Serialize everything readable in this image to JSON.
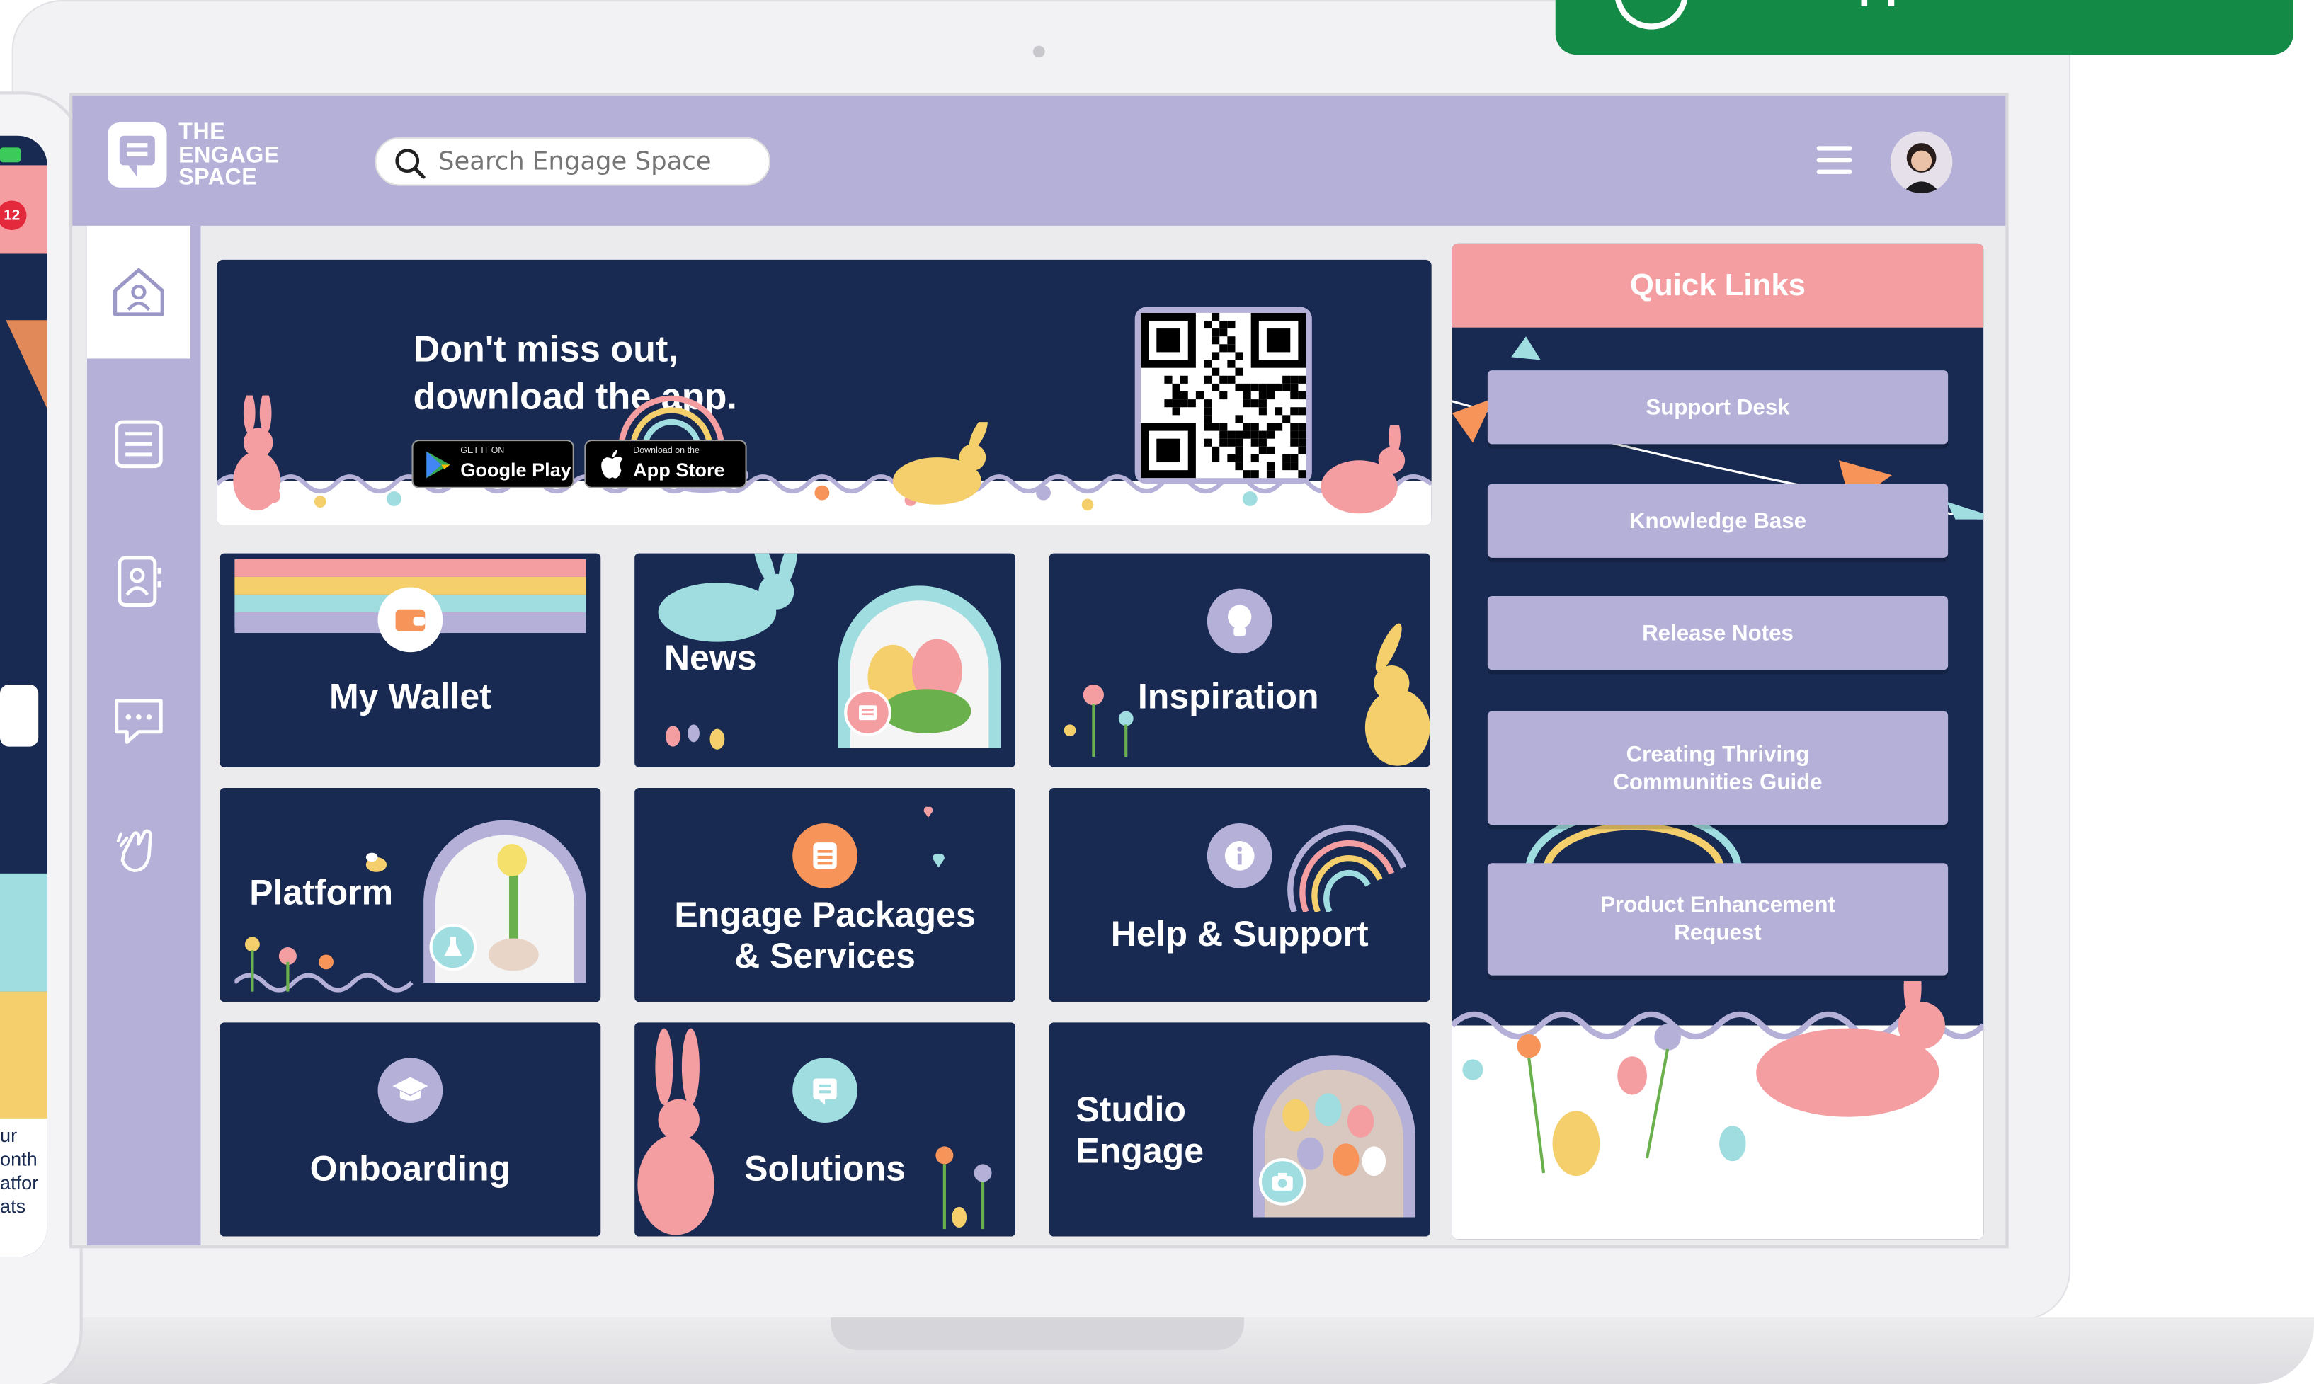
{
  "brand": {
    "line1": "THE",
    "line2": "ENGAGE",
    "line3": "SPACE"
  },
  "search": {
    "placeholder": "Search Engage Space",
    "icon": "search-icon"
  },
  "header": {
    "menu_icon": "hamburger-menu-icon",
    "avatar": "user-avatar"
  },
  "sidebar": {
    "items": [
      {
        "icon": "home-icon"
      },
      {
        "icon": "news-icon"
      },
      {
        "icon": "contacts-icon"
      },
      {
        "icon": "chat-icon"
      },
      {
        "icon": "clap-hands-icon"
      }
    ]
  },
  "banner": {
    "title_line1": "Don't miss out,",
    "title_line2": "download the app.",
    "google_small": "GET IT ON",
    "google_big": "Google Play",
    "apple_small": "Download on the",
    "apple_big": "App Store"
  },
  "tiles": [
    {
      "label": "My Wallet",
      "icon": "wallet-icon"
    },
    {
      "label": "News",
      "icon": "newspaper-icon"
    },
    {
      "label": "Inspiration",
      "icon": "lightbulb-icon"
    },
    {
      "label": "Platform",
      "icon": "flask-icon"
    },
    {
      "label_line1": "Engage Packages",
      "label_line2": "& Services",
      "icon": "list-icon"
    },
    {
      "label": "Help & Support",
      "icon": "info-icon"
    },
    {
      "label": "Onboarding",
      "icon": "graduation-cap-icon"
    },
    {
      "label": "Solutions",
      "icon": "engage-logo-icon"
    },
    {
      "label_line1": "Studio",
      "label_line2": "Engage",
      "icon": "camera-icon"
    }
  ],
  "quick_links": {
    "title": "Quick Links",
    "items": [
      {
        "label": "Support Desk"
      },
      {
        "label": "Knowledge Base"
      },
      {
        "label": "Release Notes"
      },
      {
        "label_line1": "Creating Thriving",
        "label_line2": "Communities Guide"
      },
      {
        "label_line1": "Product Enhancement",
        "label_line2": "Request"
      }
    ]
  },
  "toast": {
    "text": "been applied"
  },
  "phone": {
    "badge": "12",
    "text_line1": "ur",
    "text_line2": "onth",
    "text_line3": "atfor",
    "text_line4": "ats"
  },
  "colors": {
    "lavender": "#b4b0d8",
    "navy": "#182a52",
    "pink": "#f49ea2",
    "orange": "#f7945a",
    "green_toast": "#148a47",
    "yellow": "#f4cf6b",
    "teal": "#9fdde0"
  }
}
